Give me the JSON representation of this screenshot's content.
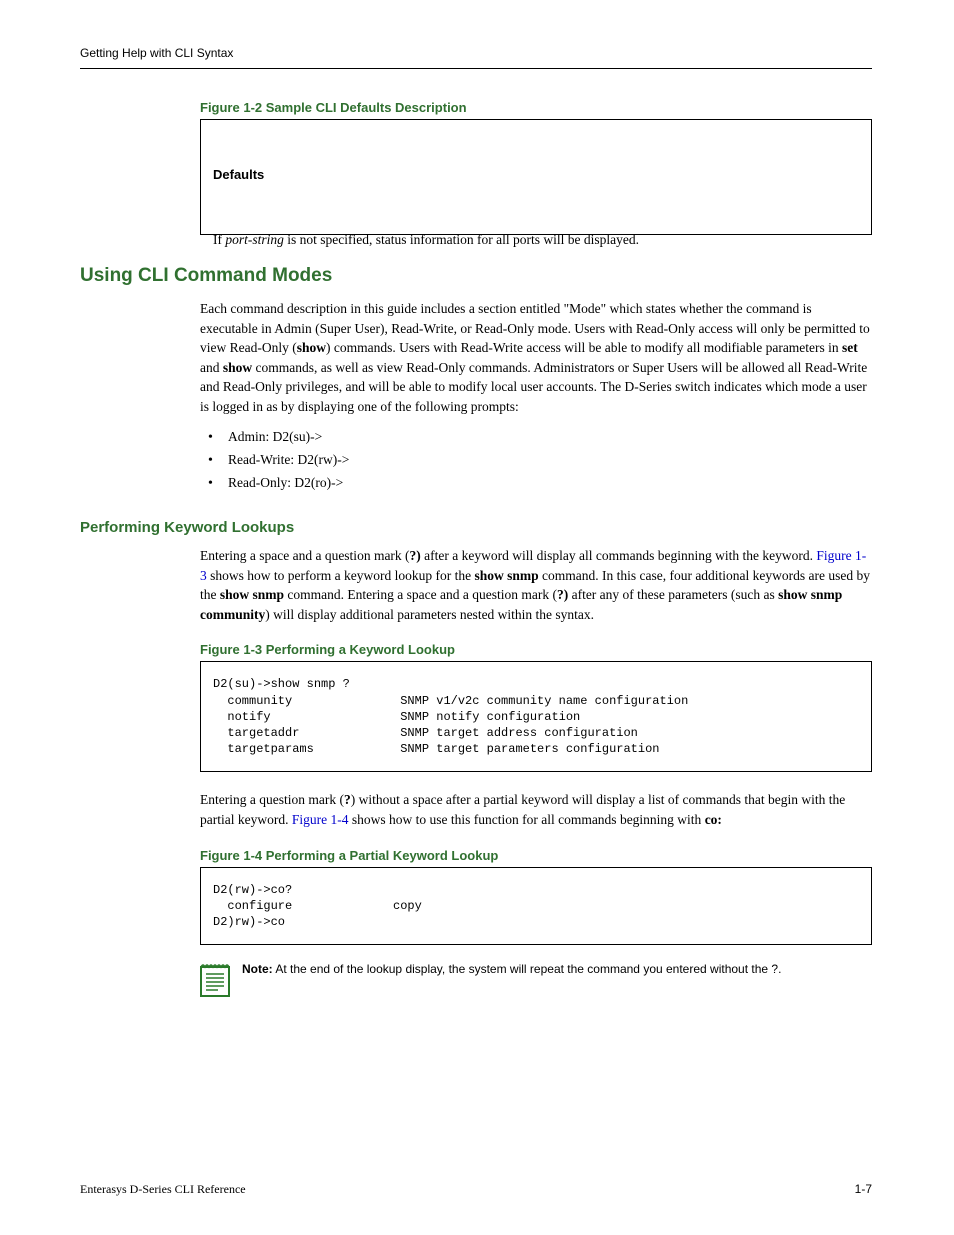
{
  "header": {
    "left": "Getting Help with CLI Syntax"
  },
  "fig12": {
    "caption": "Figure 1-2   Sample CLI Defaults Description",
    "label": "Defaults",
    "pre_if": "If ",
    "ital": "port-string",
    "post": " is not specified, status information for all ports will be displayed."
  },
  "modes": {
    "heading": "Using CLI Command Modes",
    "para": "Each command description in this guide includes a section entitled \"Mode\" which states whether the command is executable in Admin (Super User), Read-Write, or Read-Only mode. Users with Read-Only access will only be permitted to view Read-Only (",
    "show": "show",
    "para2": ") commands. Users with Read-Write access will be able to modify all modifiable parameters in ",
    "set": "set",
    "and": " and ",
    "show2": "show",
    "para3": " commands, as well as view Read-Only commands. Administrators or Super Users will be allowed all Read-Write and Read-Only privileges, and will be able to modify local user accounts. The D-Series switch indicates which mode a user is logged in as by displaying one of the following prompts:",
    "bullets": [
      "Admin: D2(su)->",
      "Read-Write: D2(rw)->",
      "Read-Only: D2(ro)->"
    ]
  },
  "keyword": {
    "heading": "Performing Keyword Lookups",
    "p1a": "Entering a space and a question mark (",
    "q1": "?)",
    "p1b": " after a keyword will display all commands beginning with the keyword. ",
    "link1": "Figure 1-3",
    "p1c": " shows how to perform a keyword lookup for the ",
    "bold1": "show snmp",
    "p1d": " command. In this case, four additional keywords are used by the ",
    "bold2": "show snmp",
    "p1e": " command. Entering a space and a question mark (",
    "q2": "?)",
    "p1f": " after any of these parameters (such as ",
    "bold3": "show snmp community",
    "p1g": ") will display additional parameters nested within the syntax."
  },
  "fig13": {
    "caption": "Figure 1-3   Performing a Keyword Lookup",
    "line1": "D2(su)->show snmp ?",
    "line2": "  community               SNMP v1/v2c community name configuration",
    "line3": "  notify                  SNMP notify configuration",
    "line4": "  targetaddr              SNMP target address configuration",
    "line5": "  targetparams            SNMP target parameters configuration"
  },
  "partial": {
    "p1a": "Entering a question mark (",
    "q": "?",
    "p1b": ") without a space after a partial keyword will display a list of commands that begin with the partial keyword. ",
    "link": "Figure 1-4",
    "p1c": " shows how to use this function for all commands beginning with ",
    "bold": "co:"
  },
  "fig14": {
    "caption": "Figure 1-4   Performing a Partial Keyword Lookup",
    "line1": "D2(rw)->co?",
    "line2": "  configure              copy",
    "line3": "D2)rw)->co"
  },
  "note": {
    "bold": "Note:",
    "text": " At the end of the lookup display, the system will repeat the command you entered without the ?."
  },
  "footer": {
    "left": "Enterasys D-Series CLI Reference",
    "right": "1-7"
  }
}
